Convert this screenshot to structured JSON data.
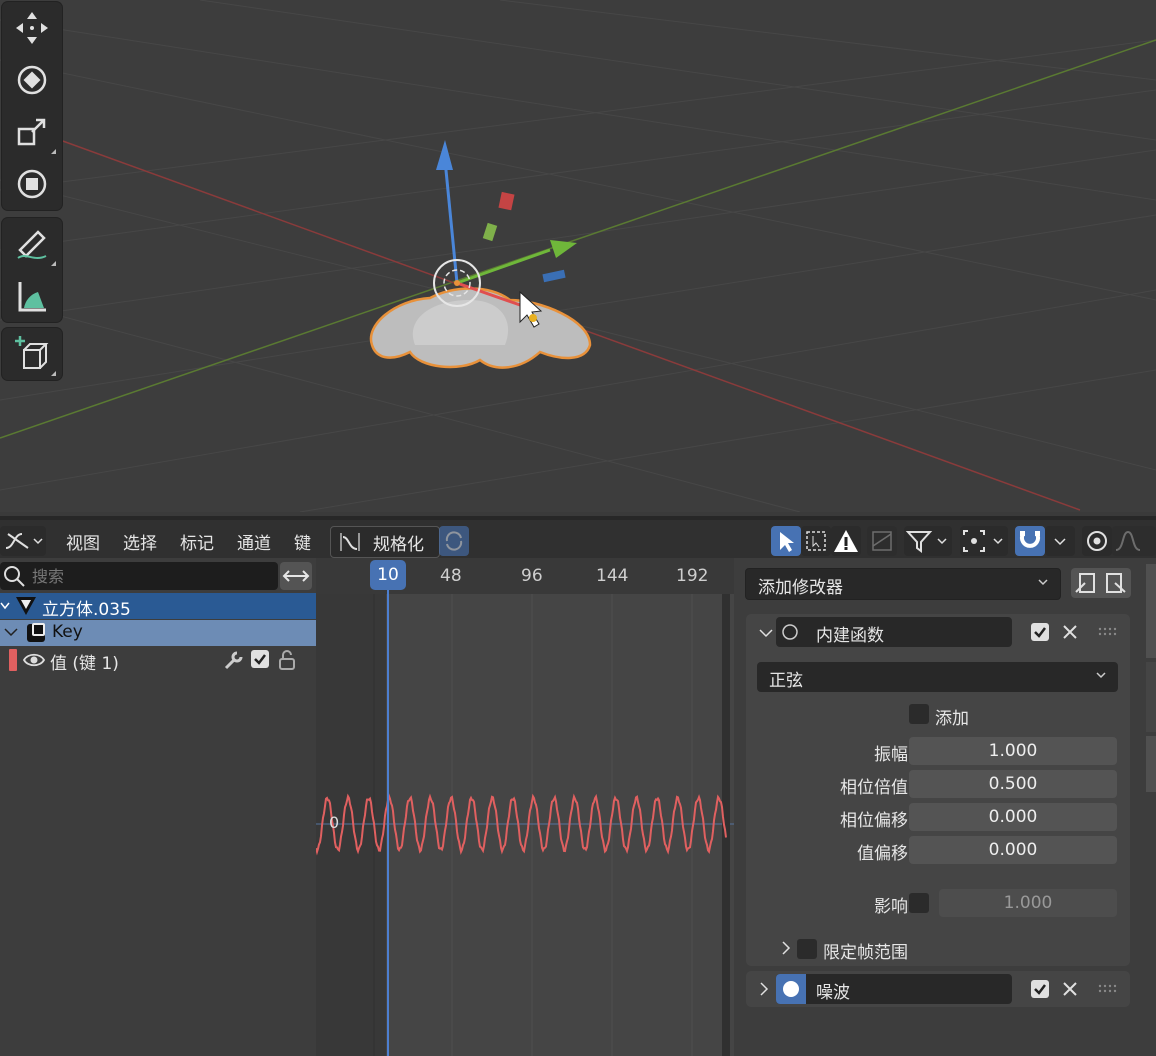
{
  "header": {
    "menus": [
      "视图",
      "选择",
      "标记",
      "通道",
      "键"
    ],
    "normalize_label": "规格化"
  },
  "channels": {
    "search_placeholder": "搜索",
    "object_name": "立方体.035",
    "action_name": "Key",
    "fcurve_name": "值 (键 1)",
    "fcurve_color": "#e06060"
  },
  "graph": {
    "current_frame": "10",
    "ticks": [
      "0",
      "48",
      "96",
      "144",
      "192"
    ],
    "zero_label": "0",
    "curve_color": "#e06060"
  },
  "sidebar": {
    "add_modifier": "添加修改器",
    "modifier1": {
      "name": "内建函数",
      "func_type": "正弦",
      "additive_label": "添加",
      "fields": [
        {
          "label": "振幅",
          "value": "1.000"
        },
        {
          "label": "相位倍值",
          "value": "0.500"
        },
        {
          "label": "相位偏移",
          "value": "0.000"
        },
        {
          "label": "值偏移",
          "value": "0.000"
        }
      ],
      "influence_label": "影响",
      "influence_value": "1.000",
      "frame_range_label": "限定帧范围"
    },
    "modifier2": {
      "name": "噪波"
    }
  }
}
